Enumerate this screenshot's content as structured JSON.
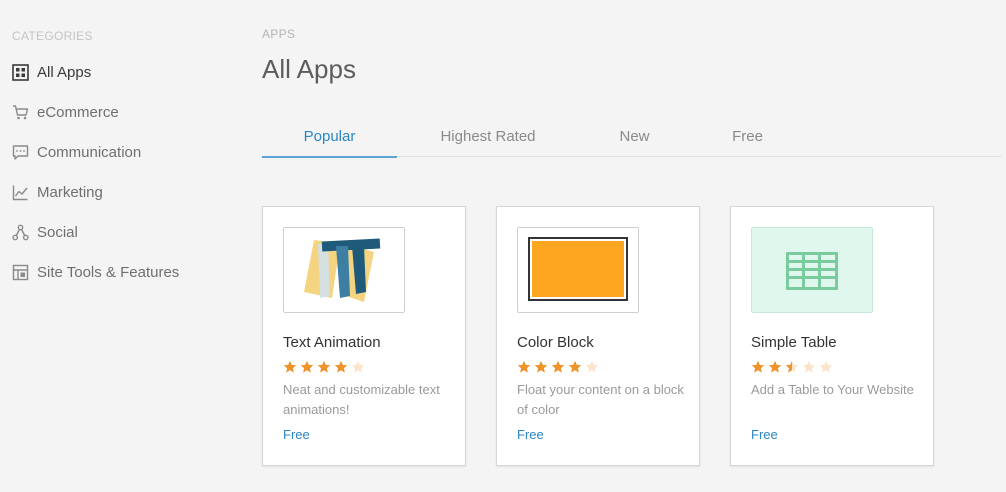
{
  "sidebar": {
    "heading": "CATEGORIES",
    "items": [
      {
        "label": "All Apps",
        "icon": "grid-icon",
        "active": true
      },
      {
        "label": "eCommerce",
        "icon": "cart-icon",
        "active": false
      },
      {
        "label": "Communication",
        "icon": "chat-icon",
        "active": false
      },
      {
        "label": "Marketing",
        "icon": "chart-icon",
        "active": false
      },
      {
        "label": "Social",
        "icon": "share-icon",
        "active": false
      },
      {
        "label": "Site Tools & Features",
        "icon": "tools-icon",
        "active": false
      }
    ]
  },
  "main": {
    "breadcrumb": "APPS",
    "title": "All Apps",
    "tabs": [
      {
        "label": "Popular",
        "active": true
      },
      {
        "label": "Highest Rated",
        "active": false
      },
      {
        "label": "New",
        "active": false
      },
      {
        "label": "Free",
        "active": false
      }
    ],
    "apps": [
      {
        "name": "Text Animation",
        "rating": 4,
        "description": "Neat and customizable text animations!",
        "price": "Free",
        "thumb_icon": "text-animation-icon"
      },
      {
        "name": "Color Block",
        "rating": 4,
        "description": "Float your content on a block of color",
        "price": "Free",
        "thumb_icon": "color-block-icon",
        "block_color": "#ffa621"
      },
      {
        "name": "Simple Table",
        "rating": 2.5,
        "description": "Add a Table to Your Website",
        "price": "Free",
        "thumb_icon": "table-icon"
      }
    ]
  },
  "colors": {
    "accent": "#2b86c5",
    "star": "#f0932b",
    "star_empty": "#fbe3cc",
    "background": "#f4f4f4"
  }
}
